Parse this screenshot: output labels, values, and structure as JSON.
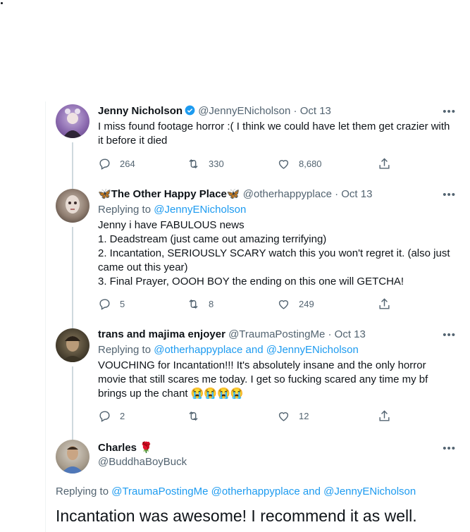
{
  "tweets": [
    {
      "name": "Jenny Nicholson",
      "handle": "@JennyENicholson",
      "date": "Oct 13",
      "lines": [
        "I miss found footage horror :( I think we could have let them get crazier with",
        "it before it died"
      ],
      "replies": "264",
      "retweets": "330",
      "likes": "8,680"
    },
    {
      "name_prefix": "🦋",
      "name": "The Other Happy Place",
      "name_suffix": "🦋",
      "handle": "@otherhappyplace",
      "date": "Oct 13",
      "replying_label": "Replying to",
      "replying_to": "@JennyENicholson",
      "lines": [
        "Jenny i have FABULOUS news",
        "1. Deadstream (just came out amazing terrifying)",
        "2. Incantation, SERIOUSLY SCARY watch this you won't regret it. (also just",
        "came out this year)",
        "3. Final Prayer, OOOH BOY the ending on this one will GETCHA!"
      ],
      "replies": "5",
      "retweets": "8",
      "likes": "249"
    },
    {
      "name": "trans and majima enjoyer",
      "handle": "@TraumaPostingMe",
      "date": "Oct 13",
      "replying_label": "Replying to",
      "replying_to": "@otherhappyplace and @JennyENicholson",
      "lines": [
        "VOUCHING for Incantation!!! It's absolutely insane and the only horror",
        "movie that still scares me today. I get so fucking scared any time my bf",
        "brings up the chant 😭😭😭😭"
      ],
      "replies": "2",
      "retweets": "",
      "likes": "12"
    },
    {
      "name": "Charles",
      "name_suffix": "🌹",
      "handle": "@BuddhaBoyBuck",
      "replying_label": "Replying to",
      "replying_to": "@TraumaPostingMe @otherhappyplace and @JennyENicholson",
      "text": "Incantation was awesome! I recommend it as well."
    }
  ],
  "separator": "·",
  "more_glyph": "•••",
  "colors": {
    "accent": "#1d9bf0",
    "muted": "#536471",
    "text": "#0f1419",
    "line": "#cfd9de"
  }
}
